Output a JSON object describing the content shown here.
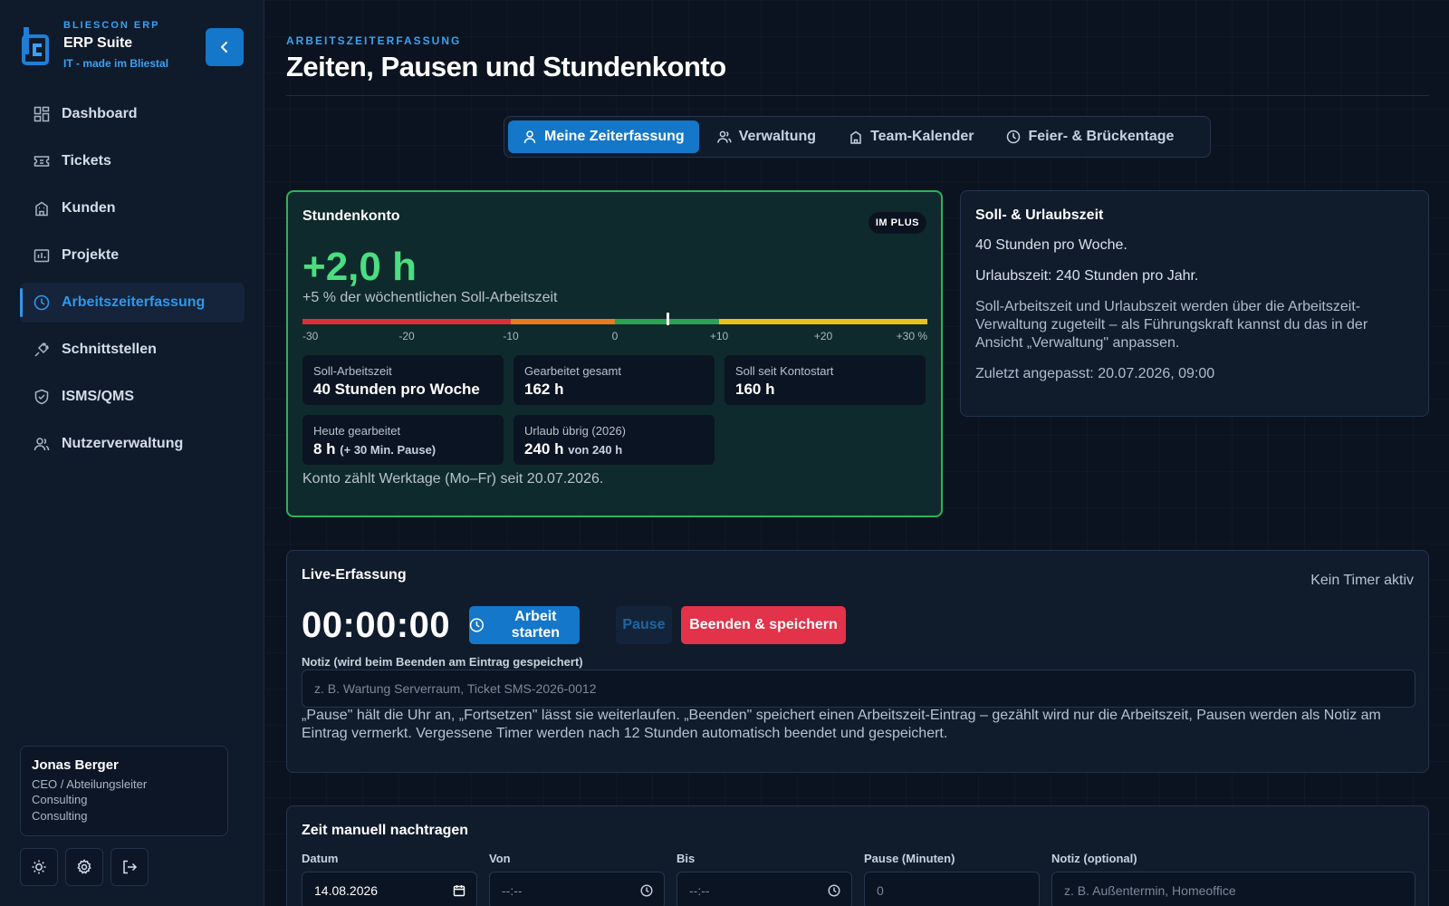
{
  "brand": {
    "kicker": "BLIESCON ERP",
    "name": "ERP Suite",
    "tagline": "IT - made im Bliestal"
  },
  "sidebar": {
    "items": [
      {
        "label": "Dashboard",
        "icon": "dashboard-icon"
      },
      {
        "label": "Tickets",
        "icon": "ticket-icon"
      },
      {
        "label": "Kunden",
        "icon": "building-icon"
      },
      {
        "label": "Projekte",
        "icon": "project-icon"
      },
      {
        "label": "Arbeitszeiterfassung",
        "icon": "clock-icon",
        "active": true
      },
      {
        "label": "Schnittstellen",
        "icon": "plug-icon"
      },
      {
        "label": "ISMS/QMS",
        "icon": "shield-check-icon"
      },
      {
        "label": "Nutzerverwaltung",
        "icon": "users-icon"
      }
    ]
  },
  "user": {
    "name": "Jonas Berger",
    "role": "CEO / Abteilungsleiter",
    "dept1": "Consulting",
    "dept2": "Consulting"
  },
  "page": {
    "kicker": "ARBEITSZEITERFASSUNG",
    "title": "Zeiten, Pausen und Stundenkonto"
  },
  "tabs": [
    {
      "label": "Meine Zeiterfassung",
      "icon": "user-icon",
      "active": true
    },
    {
      "label": "Verwaltung",
      "icon": "users-icon"
    },
    {
      "label": "Team-Kalender",
      "icon": "building-icon"
    },
    {
      "label": "Feier- & Brückentage",
      "icon": "clock-icon"
    }
  ],
  "account": {
    "title": "Stundenkonto",
    "badge": "IM PLUS",
    "value": "+2,0 h",
    "subtitle": "+5 % der wöchentlichen Soll-Arbeitszeit",
    "gauge_value_percent": 5,
    "gauge_range": [
      -30,
      30
    ],
    "gauge_ticks": [
      "-30",
      "-20",
      "-10",
      "0",
      "+10",
      "+20",
      "+30 %"
    ],
    "stats": {
      "soll_label": "Soll-Arbeitszeit",
      "soll_value": "40 Stunden pro Woche",
      "gearbeitet_label": "Gearbeitet gesamt",
      "gearbeitet_value": "162 h",
      "soll_seit_label": "Soll seit Kontostart",
      "soll_seit_value": "160 h",
      "heute_label": "Heute gearbeitet",
      "heute_value": "8 h",
      "heute_suffix": "(+ 30 Min. Pause)",
      "urlaub_label": "Urlaub übrig (2026)",
      "urlaub_value": "240 h",
      "urlaub_suffix": "von 240 h"
    },
    "footer": "Konto zählt Werktage (Mo–Fr) seit 20.07.2026."
  },
  "soll": {
    "title": "Soll- & Urlaubszeit",
    "line1": "40 Stunden pro Woche.",
    "line2": "Urlaubszeit: 240 Stunden pro Jahr.",
    "line3": "Soll-Arbeitszeit und Urlaubszeit werden über die Arbeitszeit-Verwaltung zugeteilt – als Führungskraft kannst du das in der Ansicht „Verwaltung\" anpassen.",
    "line4": "Zuletzt angepasst: 20.07.2026, 09:00"
  },
  "live": {
    "title": "Live-Erfassung",
    "status": "Kein Timer aktiv",
    "timer": "00:00:00",
    "start_label": "Arbeit starten",
    "pause_label": "Pause",
    "stop_label": "Beenden & speichern",
    "note_label": "Notiz (wird beim Beenden am Eintrag gespeichert)",
    "note_placeholder": "z. B. Wartung Serverraum, Ticket SMS-2026-0012",
    "help": "„Pause\" hält die Uhr an, „Fortsetzen\" lässt sie weiterlaufen. „Beenden\" speichert einen Arbeitszeit-Eintrag – gezählt wird nur die Arbeitszeit, Pausen werden als Notiz am Eintrag vermerkt. Vergessene Timer werden nach 12 Stunden automatisch beendet und gespeichert."
  },
  "manual": {
    "title": "Zeit manuell nachtragen",
    "date_label": "Datum",
    "date_value": "14.08.2026",
    "from_label": "Von",
    "from_placeholder": "--:--",
    "to_label": "Bis",
    "to_placeholder": "--:--",
    "pause_label": "Pause (Minuten)",
    "pause_placeholder": "0",
    "note_label": "Notiz (optional)",
    "note_placeholder": "z. B. Außentermin, Homeoffice"
  },
  "colors": {
    "accent": "#1477c9",
    "positive": "#4ade80",
    "danger": "#e2334a",
    "gauge_red": "#dc2f36",
    "gauge_orange": "#ea7a1e",
    "gauge_green": "#2aa352",
    "gauge_yellow": "#e8c21a"
  }
}
